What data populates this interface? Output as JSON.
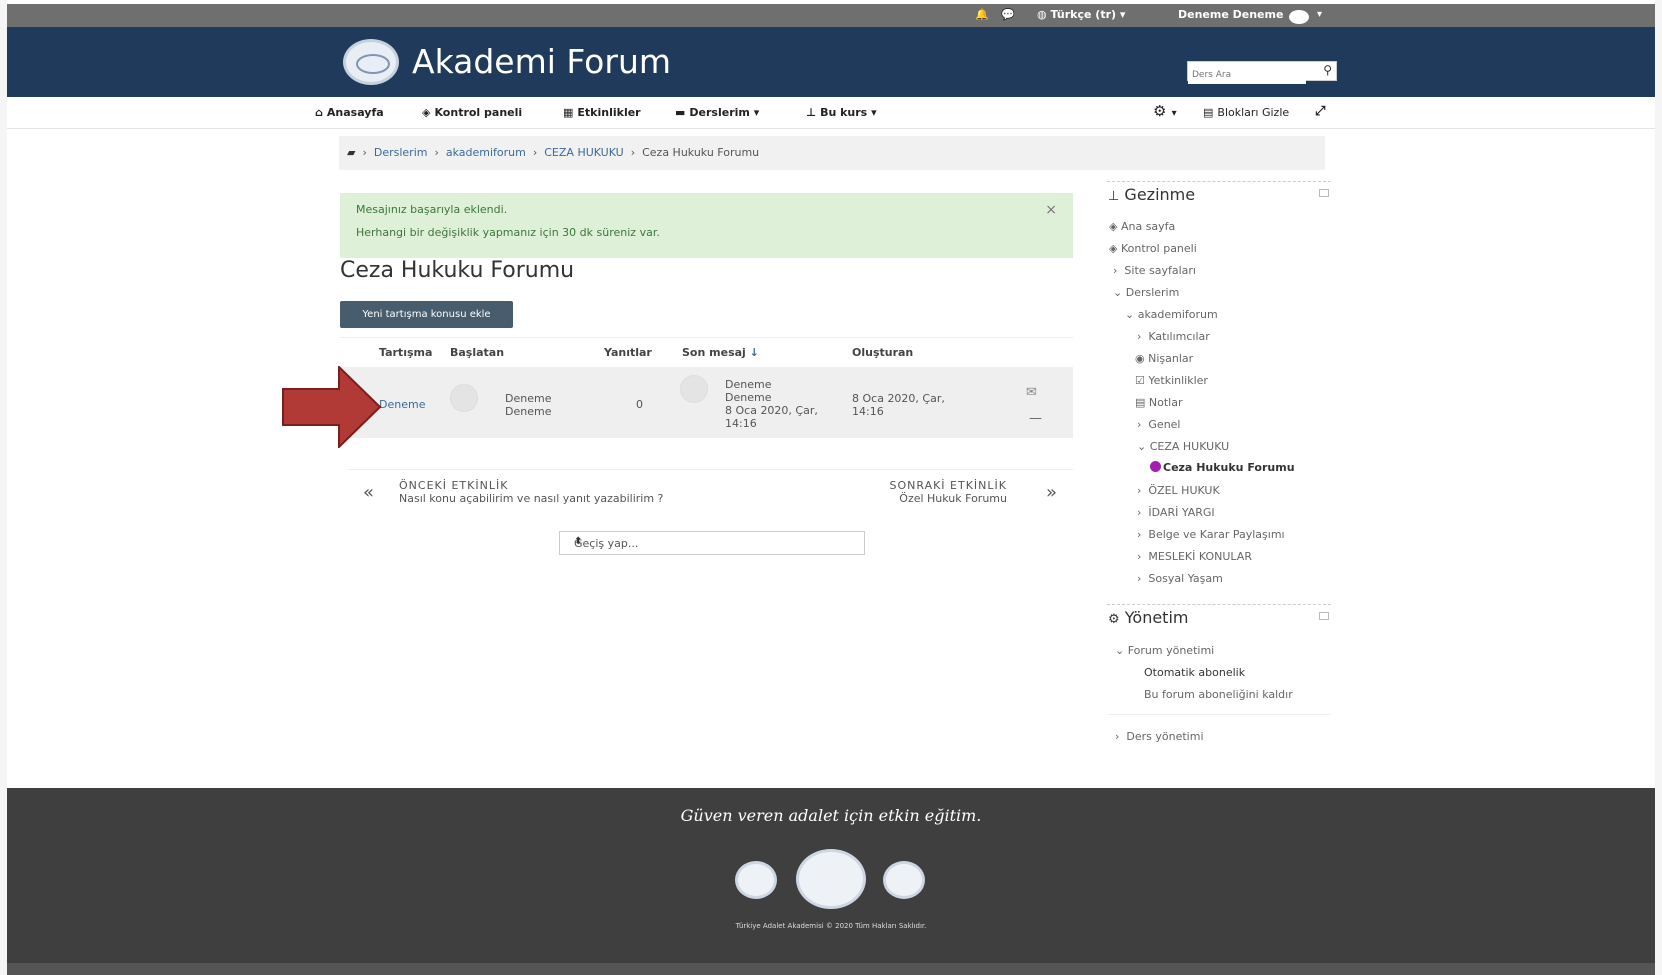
{
  "topbar": {
    "language": "Türkçe (tr)",
    "user_name": "Deneme Deneme"
  },
  "header": {
    "brand": "Akademi Forum",
    "search_placeholder": "Ders Ara"
  },
  "nav": {
    "items": [
      {
        "label": "Anasayfa",
        "icon": "home-icon"
      },
      {
        "label": "Kontrol paneli",
        "icon": "dashboard-icon"
      },
      {
        "label": "Etkinlikler",
        "icon": "calendar-icon"
      },
      {
        "label": "Derslerim",
        "icon": "briefcase-icon"
      },
      {
        "label": "Bu kurs",
        "icon": "sitemap-icon"
      }
    ],
    "hide_blocks": "Blokları Gizle"
  },
  "breadcrumb": {
    "items": [
      "Derslerim",
      "akademiforum",
      "CEZA HUKUKU",
      "Ceza Hukuku Forumu"
    ]
  },
  "alert": {
    "line1": "Mesajınız başarıyla eklendi.",
    "line2": "Herhangi bir değişiklik yapmanız için 30 dk süreniz var.",
    "close": "×"
  },
  "forum": {
    "title": "Ceza Hukuku Forumu",
    "new_topic_button": "Yeni tartışma konusu ekle",
    "columns": {
      "discussion": "Tartışma",
      "started_by": "Başlatan",
      "replies": "Yanıtlar",
      "last_post": "Son mesaj",
      "last_post_sort": "↓",
      "created": "Oluşturan"
    },
    "rows": [
      {
        "discussion": "Deneme",
        "starter_line1": "Deneme",
        "starter_line2": "Deneme",
        "replies": "0",
        "last_line1": "Deneme",
        "last_line2": "Deneme",
        "last_line3": "8 Oca 2020, Çar,",
        "last_line4": "14:16",
        "created_line1": "8 Oca 2020, Çar,",
        "created_line2": "14:16"
      }
    ]
  },
  "prevnext": {
    "prev_label": "ÖNCEKİ ETKİNLİK",
    "prev_title": "Nasıl konu açabilirim ve nasıl yanıt yazabilirim ?",
    "next_label": "SONRAKİ ETKİNLİK",
    "next_title": "Özel Hukuk Forumu"
  },
  "jump": {
    "label": "Geçiş yap..."
  },
  "navigation_block": {
    "title": "Gezinme",
    "items": [
      "Ana sayfa",
      "Kontrol paneli",
      "Site sayfaları",
      "Derslerim",
      "akademiforum",
      "Katılımcılar",
      "Nişanlar",
      "Yetkinlikler",
      "Notlar",
      "Genel",
      "CEZA HUKUKU",
      "Ceza Hukuku Forumu",
      "ÖZEL HUKUK",
      "İDARİ YARGI",
      "Belge ve Karar Paylaşımı",
      "MESLEKİ KONULAR",
      "Sosyal Yaşam"
    ]
  },
  "admin_block": {
    "title": "Yönetim",
    "forum_admin": "Forum yönetimi",
    "auto_subscribe": "Otomatik abonelik",
    "unsubscribe": "Bu forum aboneliğini kaldır",
    "course_admin": "Ders yönetimi"
  },
  "footer": {
    "slogan": "Güven veren adalet için etkin eğitim.",
    "copyright": "Türkiye Adalet Akademisi © 2020 Tüm Hakları Saklıdır."
  }
}
